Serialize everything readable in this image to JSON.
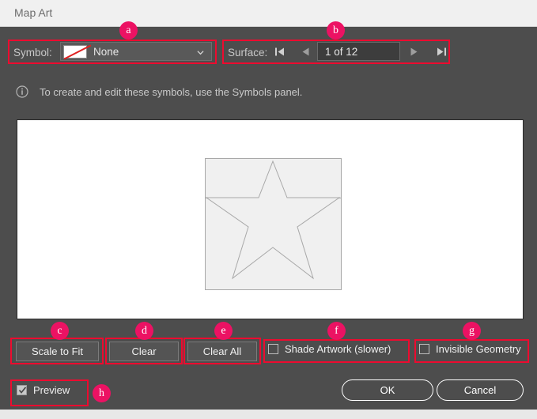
{
  "window": {
    "title": "Map Art"
  },
  "symbol_row": {
    "label": "Symbol:",
    "selected": "None",
    "swatch_icon": "none-swatch-icon",
    "caret_icon": "chevron-down-icon"
  },
  "surface_row": {
    "label": "Surface:",
    "value": "1 of 12",
    "first_icon": "first-surface-icon",
    "prev_icon": "previous-surface-icon",
    "next_icon": "next-surface-icon",
    "last_icon": "last-surface-icon"
  },
  "note": {
    "icon": "info-icon",
    "text": "To create and edit these symbols, use the Symbols panel."
  },
  "preview": {
    "artwork_icon": "star-artwork-icon",
    "shape_fill": "#f0f0f0",
    "shape_stroke": "#a8a8a8"
  },
  "buttons": {
    "scale_to_fit": "Scale to Fit",
    "clear": "Clear",
    "clear_all": "Clear All",
    "ok": "OK",
    "cancel": "Cancel"
  },
  "checkboxes": {
    "shade_artwork": {
      "label": "Shade Artwork (slower)",
      "checked": false
    },
    "invisible_geometry": {
      "label": "Invisible Geometry",
      "checked": false
    },
    "preview": {
      "label": "Preview",
      "checked": true
    }
  },
  "annotations": {
    "accent_color": "#ec1263",
    "box_color": "#ed0b2f",
    "markers": [
      {
        "id": "a",
        "target": "symbol-row"
      },
      {
        "id": "b",
        "target": "surface-row"
      },
      {
        "id": "c",
        "target": "scale-to-fit-button"
      },
      {
        "id": "d",
        "target": "clear-button"
      },
      {
        "id": "e",
        "target": "clear-all-button"
      },
      {
        "id": "f",
        "target": "shade-artwork-checkbox"
      },
      {
        "id": "g",
        "target": "invisible-geometry-checkbox"
      },
      {
        "id": "h",
        "target": "preview-checkbox"
      }
    ]
  }
}
